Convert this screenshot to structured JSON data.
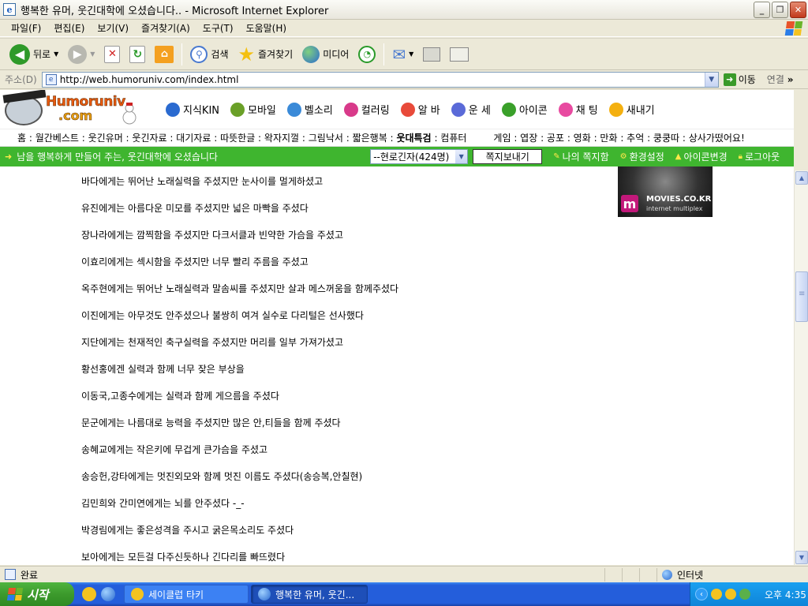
{
  "window": {
    "title": "행복한 유머, 웃긴대학에 오셨습니다.. - Microsoft Internet Explorer",
    "app_icon": "e"
  },
  "menu": [
    "파일(F)",
    "편집(E)",
    "보기(V)",
    "즐겨찾기(A)",
    "도구(T)",
    "도움말(H)"
  ],
  "toolbar": {
    "back": "뒤로",
    "search": "검색",
    "favorites": "즐겨찾기",
    "media": "미디어"
  },
  "address": {
    "label": "주소(D)",
    "url": "http://web.humoruniv.com/index.html",
    "go": "이동",
    "links": "연결",
    "more": "»"
  },
  "site": {
    "logo_top": "Humoruniv",
    "logo_bottom": ".com",
    "nav": [
      {
        "label": "지식KIN",
        "icon": "diamond-icon",
        "color": "#2a6ad0"
      },
      {
        "label": "모바일",
        "icon": "mobile-icon",
        "color": "#6aa028"
      },
      {
        "label": "벨소리",
        "icon": "bell-icon",
        "color": "#3a8ad8"
      },
      {
        "label": "컬러링",
        "icon": "color-ring-icon",
        "color": "#d83a8a"
      },
      {
        "label": "알 바",
        "icon": "hand-icon",
        "color": "#e84a3a"
      },
      {
        "label": "운 세",
        "icon": "fortune-icon",
        "color": "#5a6ad8"
      },
      {
        "label": "아이콘",
        "icon": "icon-icon",
        "color": "#3aa02a"
      },
      {
        "label": "채 팅",
        "icon": "chat-icon",
        "color": "#e84aa0"
      },
      {
        "label": "새내기",
        "icon": "newbie-icon",
        "color": "#f4b010"
      }
    ],
    "subnav_left": "홈 : 월간베스트 : 웃긴유머 : 웃긴자료 : 대기자료 : 따뜻한글 : 왁자지껄 : 그림낙서 : 짧은행복 :",
    "subnav_bold": "웃대특검",
    "subnav_mid": ": 컴퓨터",
    "subnav_right": "게임 : 엽장 : 공포 : 영화 : 만화 : 추억 : 쿵쿵따 : 상사가떴어요!",
    "greenbar": {
      "welcome": "남을 행복하게 만들어 주는, 웃긴대학에 오셨습니다",
      "users_select": "--현로긴자(424명)",
      "send_note": "쪽지보내기",
      "my_notes": "나의 쪽지함",
      "settings": "환경설정",
      "change_icon": "아이콘변경",
      "logout": "로그아웃"
    },
    "ad": {
      "brand": "MOVIES.CO.KR",
      "sub": "internet multiplex",
      "letter": "m"
    },
    "lines": [
      "바다에게는 뛰어난 노래실력을 주셨지만 눈사이를 멀게하셨고",
      "유진에게는 아름다운 미모를 주셨지만 넓은 마빡을 주셨다",
      "장나라에게는 깜찍함을 주셨지만 다크서클과 빈약한 가슴을 주셨고",
      "이효리에게는 섹시함을 주셨지만 너무 빨리 주름을 주셨고",
      "옥주현에게는 뛰어난 노래실력과 말솜씨를 주셨지만 살과 메스꺼움을 함께주셨다",
      "이진에게는 아무것도 안주셨으나 불쌍히 여겨 실수로 다리털은 선사했다",
      "지단에게는 천재적인 축구실력을 주셨지만 머리를 일부 가져가셨고",
      "황선홍에겐 실력과 함께 너무 잦은 부상을",
      "이동국,고종수에게는 실력과 함께 게으름을 주셨다",
      "문군에게는 나름대로 능력을 주셨지만 많은 안,티들을 함께 주셨다",
      "송혜교에게는 작은키에 무겁게 큰가슴을 주셨고",
      "송승헌,강타에게는 멋진외모와 함께 멋진 이름도 주셨다(송승복,안칠현)",
      "김민희와 간미연에게는 뇌를 안주셨다 -_-",
      "박경림에게는 좋은성격을 주시고 굵은목소리도 주셨다",
      "보아에게는 모든걸 다주신듯하나 긴다리를 빠뜨렸다"
    ]
  },
  "status": {
    "text": "완료",
    "zone": "인터넷"
  },
  "taskbar": {
    "start": "시작",
    "tasks": [
      "세이클럽 타키",
      "행복한 유머, 웃긴..."
    ],
    "clock": "오후 4:35"
  }
}
